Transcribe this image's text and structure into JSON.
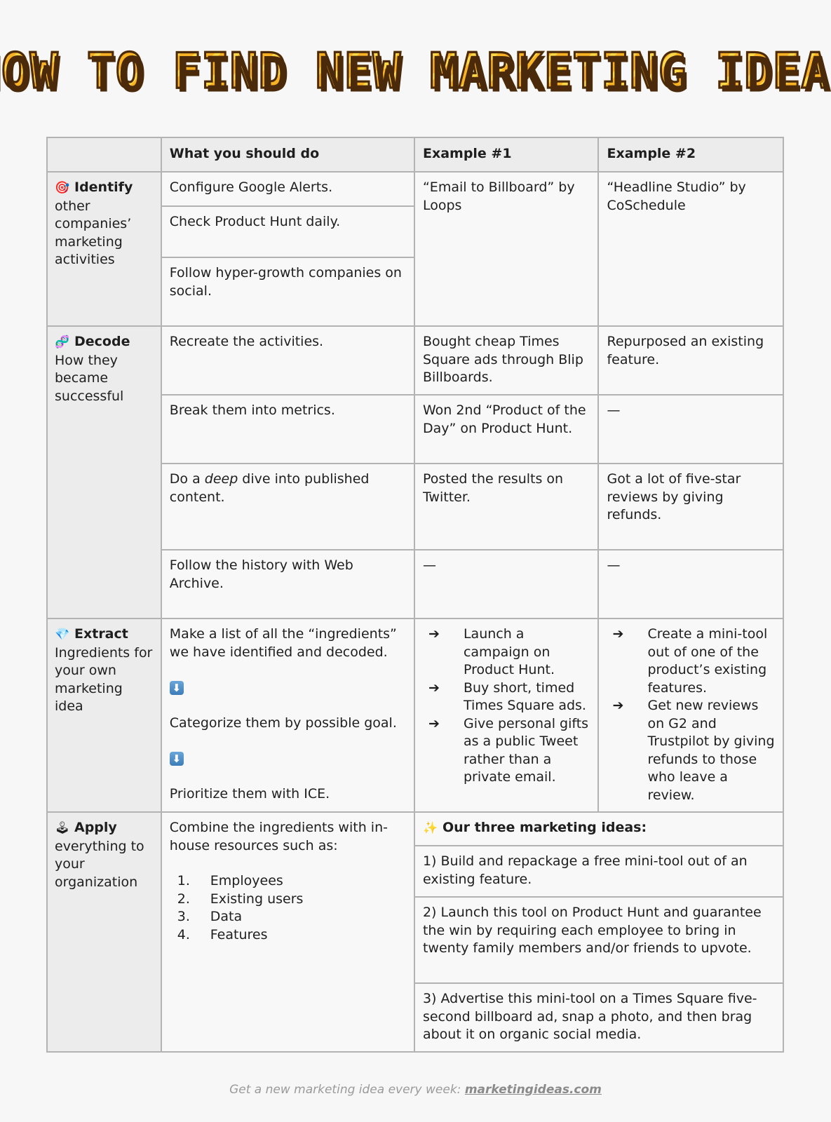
{
  "title": "HOW TO FIND NEW MARKETING IDEAS",
  "table": {
    "headers": [
      "",
      "What you should do",
      "Example #1",
      "Example #2"
    ],
    "identify": {
      "icon": "🎯",
      "icon_name": "direct-hit-target-icon",
      "title": "Identify",
      "subtitle": "other companies’ marketing activities",
      "actions": [
        "Configure Google Alerts.",
        "Check Product Hunt daily.",
        "Follow hyper-growth companies on social."
      ],
      "example1": "“Email to Billboard” by Loops",
      "example2": "“Headline Studio” by CoSchedule"
    },
    "decode": {
      "icon": "🧬",
      "icon_name": "dna-icon",
      "title": "Decode",
      "subtitle": "How they became successful",
      "rows": [
        {
          "action": "Recreate the activities.",
          "example1": "Bought cheap Times Square ads through Blip Billboards.",
          "example2": "Repurposed an existing feature."
        },
        {
          "action": "Break them into metrics.",
          "example1": "Won 2nd “Product of the Day” on Product Hunt.",
          "example2": "—"
        },
        {
          "action_pre": "Do a ",
          "action_em": "deep",
          "action_post": " dive into published content.",
          "example1": "Posted the results on Twitter.",
          "example2": "Got a lot of five-star reviews by giving refunds."
        },
        {
          "action": "Follow the history with Web Archive.",
          "example1": "—",
          "example2": "—"
        }
      ]
    },
    "extract": {
      "icon": "💎",
      "icon_name": "gem-icon",
      "title": "Extract",
      "subtitle": "Ingredients for your own marketing idea",
      "steps": [
        "Make a list of all the “ingredients” we have identified and decoded.",
        "Categorize them by possible goal.",
        "Prioritize them with ICE."
      ],
      "step_separator_icon": "⬇",
      "bullet": "➔",
      "example1": [
        "Launch a campaign on Product Hunt.",
        "Buy short, timed Times Square ads.",
        "Give personal gifts as a public Tweet rather than a private email."
      ],
      "example2": [
        "Create a mini-tool out of one of the product’s existing features.",
        "Get new reviews on G2 and Trustpilot by giving refunds to those who leave a review."
      ]
    },
    "apply": {
      "icon": "🕹",
      "icon_name": "joystick-icon",
      "title": "Apply",
      "subtitle": "everything to your organization",
      "intro": "Combine the ingredients with in-house resources such as:",
      "resources": [
        {
          "num": "1.",
          "label": "Employees"
        },
        {
          "num": "2.",
          "label": "Existing users"
        },
        {
          "num": "3.",
          "label": "Data"
        },
        {
          "num": "4.",
          "label": "Features"
        }
      ],
      "ideas_icon": "✨",
      "ideas_title": "Our three marketing ideas:",
      "ideas": [
        "1) Build and repackage a free mini-tool out of an existing feature.",
        "2) Launch this tool on Product Hunt and guarantee the win by requiring each employee to bring in twenty family members and/or friends to upvote.",
        "3) Advertise this mini-tool on a Times Square five-second billboard ad, snap a photo, and then brag about it on organic social media."
      ]
    }
  },
  "footer": {
    "text": "Get a new marketing idea every week: ",
    "link": "marketingideas.com"
  },
  "colors": {
    "title_fill": "#f9b223",
    "title_outline": "#4a2a0a",
    "stage_bg": "#ececec",
    "border": "#b3b3b3"
  }
}
